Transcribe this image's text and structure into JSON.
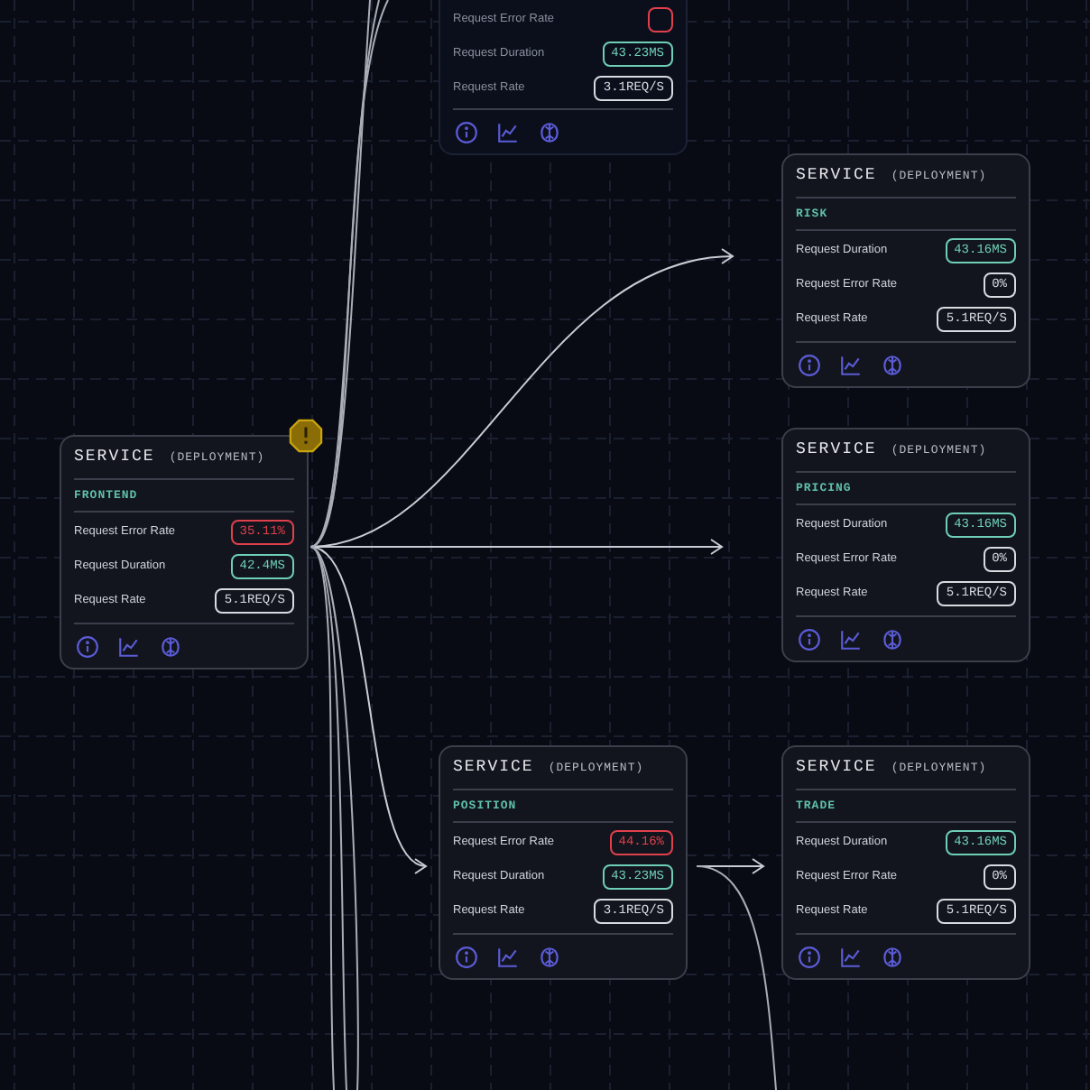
{
  "nodes": [
    {
      "title": "SERVICE",
      "subtitle": "(DEPLOYMENT)",
      "name": "FRONTEND",
      "faded": false,
      "warning": true,
      "metrics": [
        {
          "label": "Request Error Rate",
          "value": "35.11%",
          "color": "#e0404c"
        },
        {
          "label": "Request Duration",
          "value": "42.4MS",
          "color": "#6fcfb6"
        },
        {
          "label": "Request Rate",
          "value": "5.1REQ/S",
          "color": "#d8dbe0"
        }
      ]
    },
    {
      "faded": true,
      "warning": false,
      "metrics": [
        {
          "label": "Request Error Rate",
          "color": "#e0404c"
        },
        {
          "label": "Request Duration",
          "value": "43.23MS",
          "color": "#6fcfb6"
        },
        {
          "label": "Request Rate",
          "value": "3.1REQ/S",
          "color": "#d8dbe0"
        }
      ]
    },
    {
      "title": "SERVICE",
      "subtitle": "(DEPLOYMENT)",
      "name": "RISK",
      "faded": false,
      "warning": false,
      "metrics": [
        {
          "label": "Request Duration",
          "value": "43.16MS",
          "color": "#6fcfb6"
        },
        {
          "label": "Request Error Rate",
          "value": "0%",
          "color": "#d8dbe0"
        },
        {
          "label": "Request Rate",
          "value": "5.1REQ/S",
          "color": "#d8dbe0"
        }
      ]
    },
    {
      "title": "SERVICE",
      "subtitle": "(DEPLOYMENT)",
      "name": "PRICING",
      "faded": false,
      "warning": false,
      "metrics": [
        {
          "label": "Request Duration",
          "value": "43.16MS",
          "color": "#6fcfb6"
        },
        {
          "label": "Request Error Rate",
          "value": "0%",
          "color": "#d8dbe0"
        },
        {
          "label": "Request Rate",
          "value": "5.1REQ/S",
          "color": "#d8dbe0"
        }
      ]
    },
    {
      "title": "SERVICE",
      "subtitle": "(DEPLOYMENT)",
      "name": "POSITION",
      "faded": false,
      "warning": false,
      "metrics": [
        {
          "label": "Request Error Rate",
          "value": "44.16%",
          "color": "#e0404c"
        },
        {
          "label": "Request Duration",
          "value": "43.23MS",
          "color": "#6fcfb6"
        },
        {
          "label": "Request Rate",
          "value": "3.1REQ/S",
          "color": "#d8dbe0"
        }
      ]
    },
    {
      "title": "SERVICE",
      "subtitle": "(DEPLOYMENT)",
      "name": "TRADE",
      "faded": false,
      "warning": false,
      "metrics": [
        {
          "label": "Request Duration",
          "value": "43.16MS",
          "color": "#6fcfb6"
        },
        {
          "label": "Request Error Rate",
          "value": "0%",
          "color": "#d8dbe0"
        },
        {
          "label": "Request Rate",
          "value": "5.1REQ/S",
          "color": "#d8dbe0"
        }
      ]
    }
  ]
}
